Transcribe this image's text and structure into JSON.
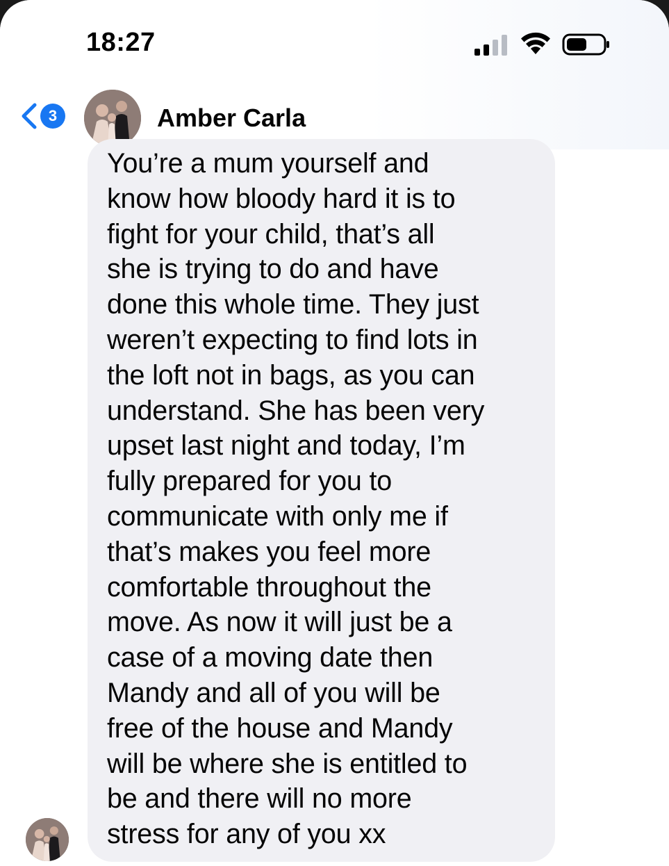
{
  "status_bar": {
    "time": "18:27"
  },
  "header": {
    "unread_count": "3",
    "contact_name": "Amber Carla"
  },
  "message": {
    "text": "You’re a mum yourself and\nknow how bloody hard it is to\nfight for your child, that’s all\nshe is trying to do and have\ndone this whole time. They just\nweren’t expecting to find lots in\nthe loft not in bags, as you can\nunderstand. She has been very\nupset last night and today, I’m\nfully prepared for you to\ncommunicate with only me if\nthat’s makes you feel more\ncomfortable throughout the\nmove. As now it will just be a\ncase of a moving date then\nMandy and all of you will be\nfree of the house and Mandy\nwill be where she is entitled to\nbe and there will no more\nstress for any of you xx"
  },
  "colors": {
    "accent": "#1877f2",
    "bubble": "#f0f0f4",
    "text": "#050505"
  },
  "icons": {
    "back": "chevron-left-icon",
    "signal": "cellular-signal-icon",
    "wifi": "wifi-icon",
    "battery": "battery-icon"
  }
}
